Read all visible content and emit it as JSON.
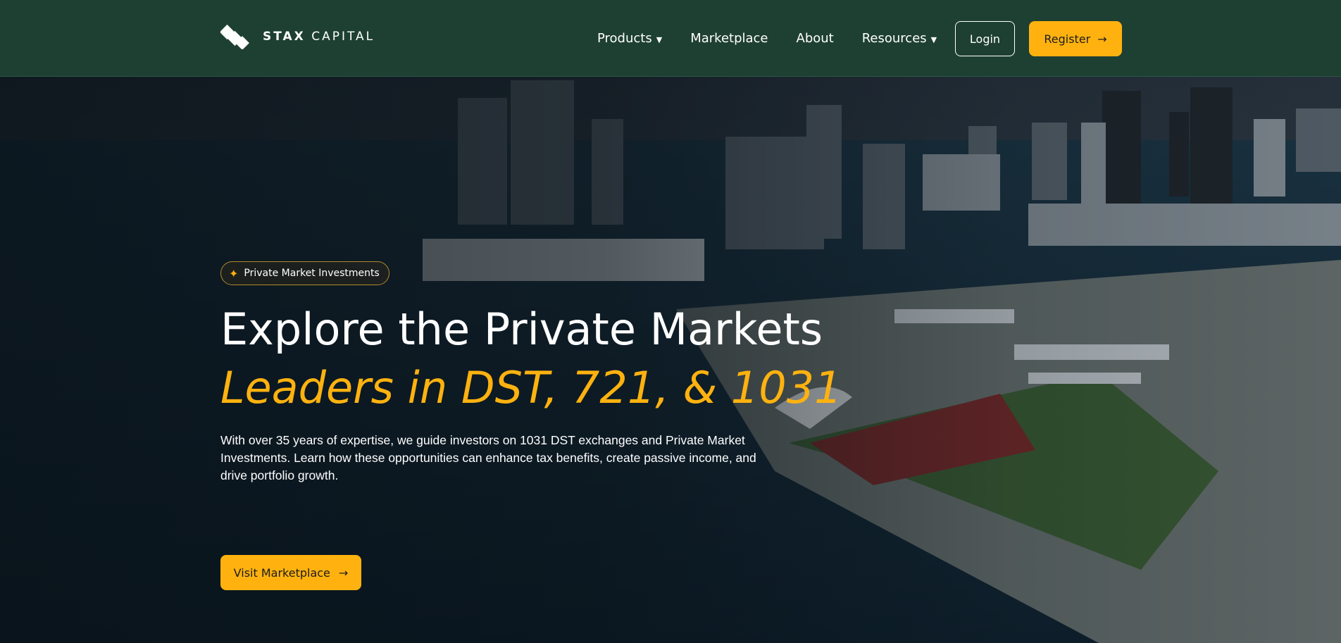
{
  "header": {
    "logo": {
      "word_bold": "STAX",
      "word_light": "CAPITAL",
      "icon": "stacked-diamonds-logo"
    },
    "nav": [
      {
        "label": "Products",
        "has_dropdown": true
      },
      {
        "label": "Marketplace",
        "has_dropdown": false
      },
      {
        "label": "About",
        "has_dropdown": false
      },
      {
        "label": "Resources",
        "has_dropdown": true
      }
    ],
    "login_label": "Login",
    "register_label": "Register",
    "dropdown_icon": "caret-down-icon",
    "arrow_icon": "arrow-right-icon"
  },
  "hero": {
    "badge": {
      "icon": "sparkle-icon",
      "label": "Private Market Investments"
    },
    "title": "Explore the Private Markets",
    "subtitle": "Leaders in DST, 721, & 1031",
    "description": "With over 35 years of expertise, we guide investors on 1031 DST exchanges and Private Market Investments. Learn how these opportunities can enhance tax benefits, create passive income, and drive portfolio growth.",
    "cta_label": "Visit Marketplace"
  },
  "colors": {
    "nav_bg": "#1e4033",
    "accent": "#ffb20f",
    "text_light": "#ffffff",
    "text_dark": "#1c1c1c"
  }
}
